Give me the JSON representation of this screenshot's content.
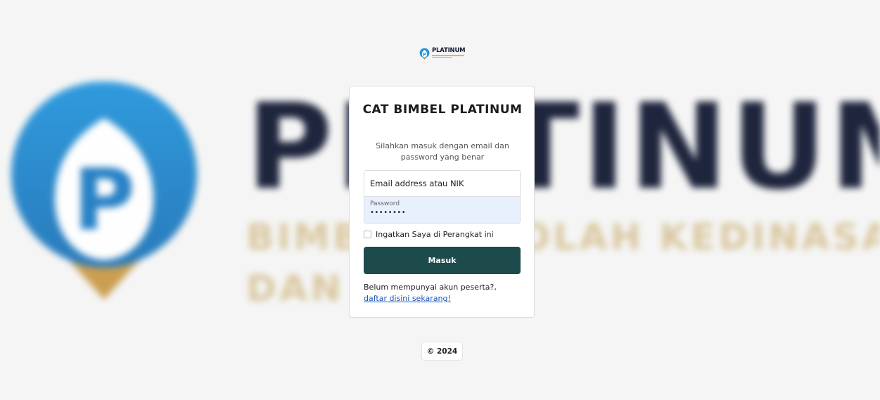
{
  "background": {
    "logo_word": "PLATINUM",
    "tagline_line1": "BIMBEL SEKOLAH KEDINASAN",
    "tagline_line2": "DAN CPNS",
    "emblem_letter": "P"
  },
  "header_logo": {
    "name": "PLATINUM",
    "icon": "platinum-emblem-icon",
    "emblem_letter": "P"
  },
  "login_card": {
    "title": "CAT BIMBEL PLATINUM",
    "subtitle": "Silahkan masuk dengan email dan password yang benar",
    "email_placeholder": "Email address atau NIK",
    "password_label": "Password",
    "password_value": "••••••••",
    "remember_label": "Ingatkan Saya di Perangkat ini",
    "submit_label": "Masuk",
    "register_prompt": "Belum mempunyai akun peserta?,",
    "register_link": "daftar disini sekarang!"
  },
  "footer": {
    "copyright": "© 2024"
  },
  "colors": {
    "page_background": "#f5f5f5",
    "primary_button": "#1d4a4a",
    "autofill_background": "#e8f0fe",
    "link": "#1a56b8",
    "brand_navy": "#131a33",
    "brand_blue": "#2a8fd4",
    "brand_gold": "#d9b56a"
  }
}
